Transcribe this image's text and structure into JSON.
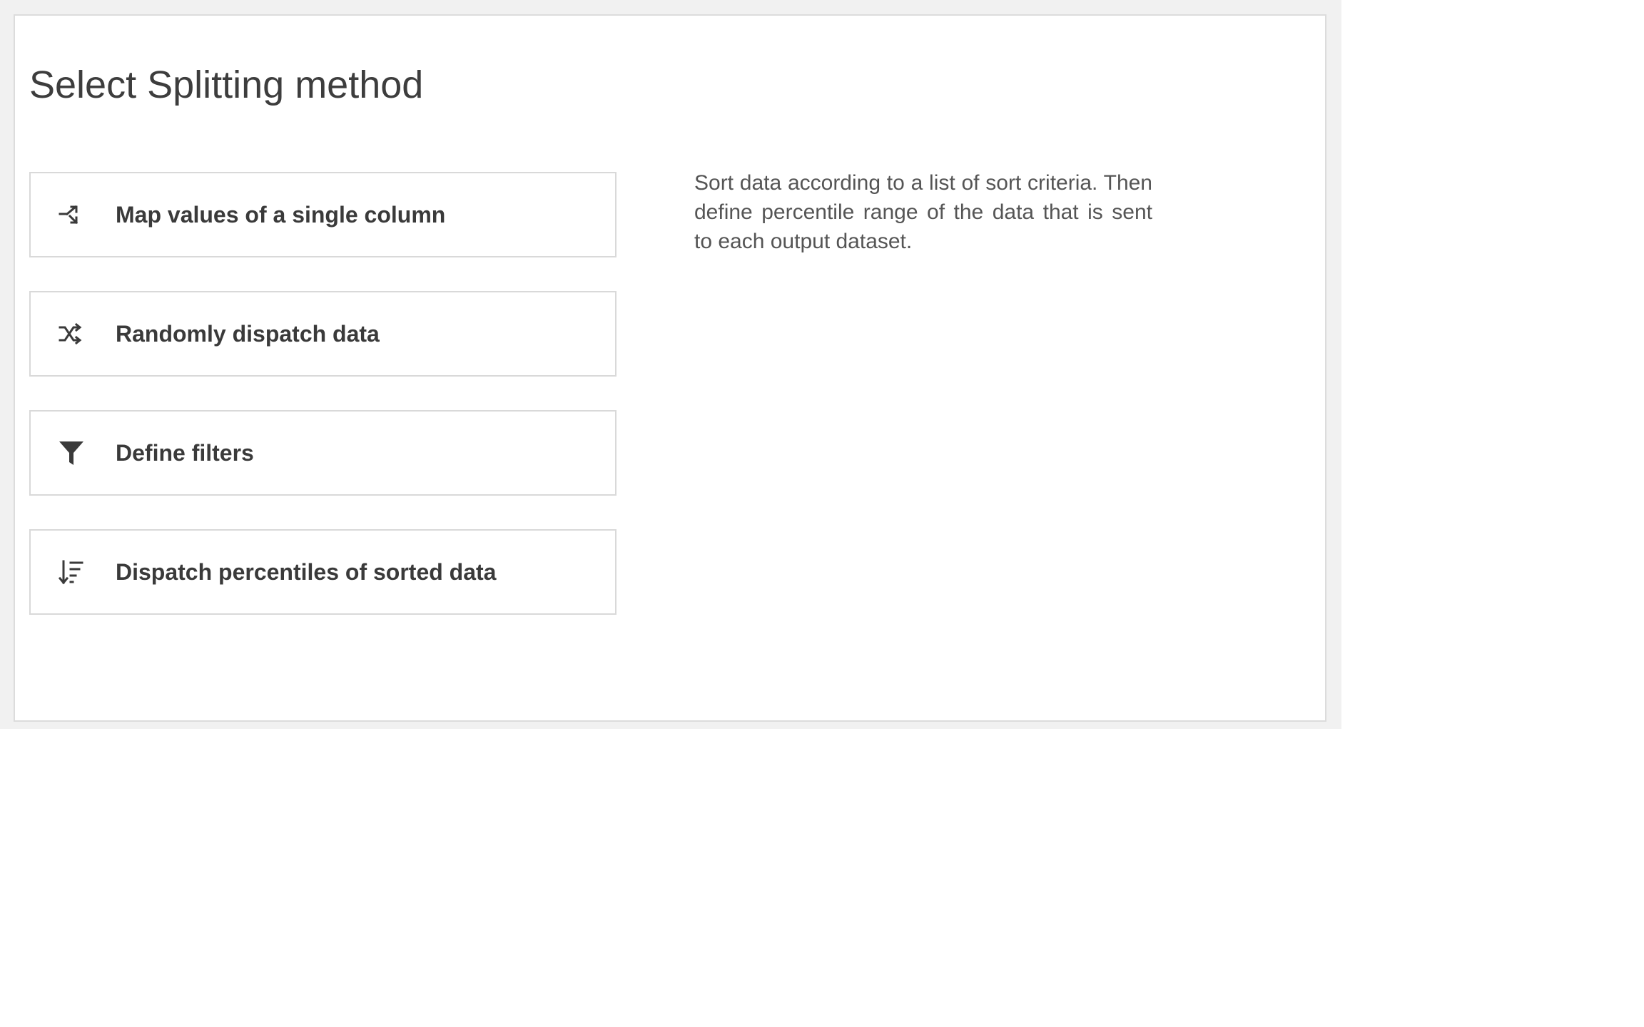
{
  "dialog": {
    "title": "Select Splitting method",
    "description": "Sort data according to a list of sort criteria. Then define percentile range of the data that is sent to each output dataset."
  },
  "options": [
    {
      "label": "Map values of a single column",
      "icon": "map-values-icon"
    },
    {
      "label": "Randomly dispatch data",
      "icon": "shuffle-icon"
    },
    {
      "label": "Define filters",
      "icon": "filter-icon"
    },
    {
      "label": "Dispatch percentiles of sorted data",
      "icon": "sort-icon"
    }
  ],
  "colors": {
    "text_primary": "#3a3a3a",
    "text_secondary": "#555555",
    "border": "#d9d9d9",
    "backdrop": "#f1f1f1"
  }
}
